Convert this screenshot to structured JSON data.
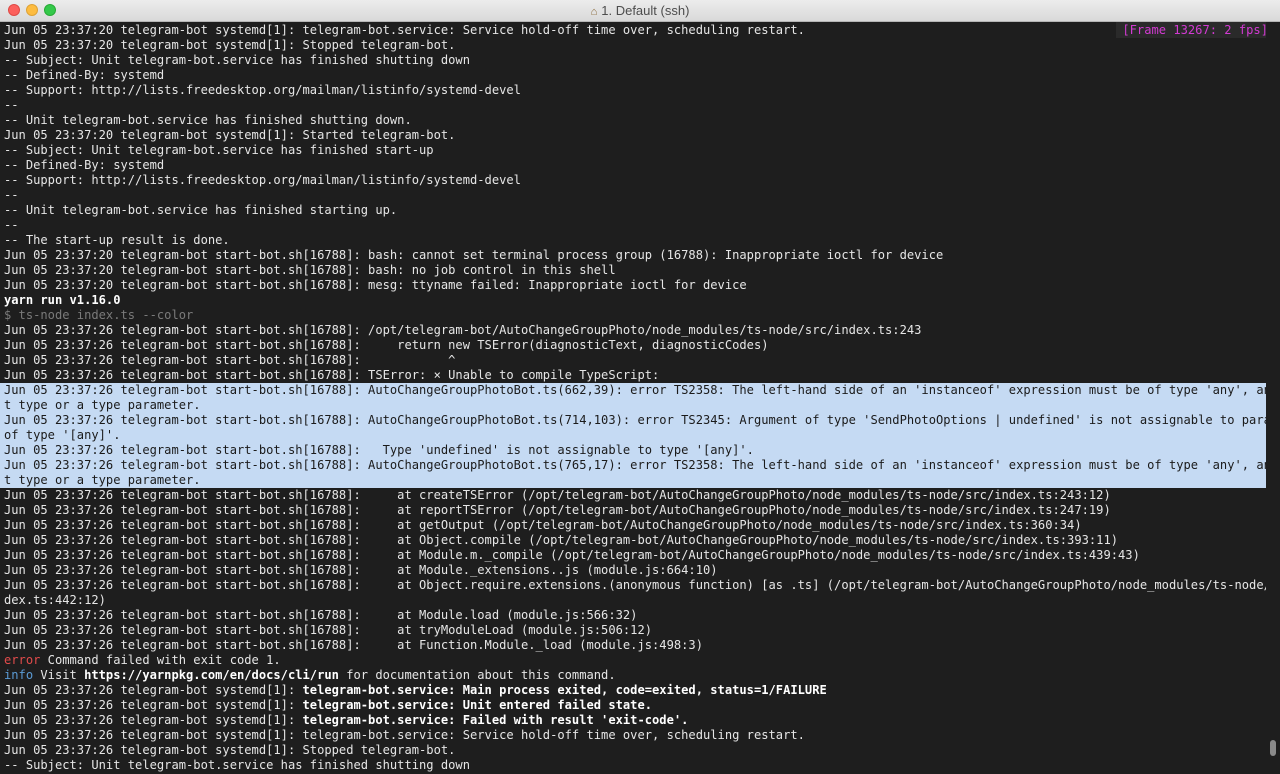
{
  "window": {
    "title": "1. Default (ssh)",
    "title_icon": "home-icon",
    "frame_badge": "[Frame 13267: 2 fps]"
  },
  "colors": {
    "background": "#1e1e1e",
    "foreground": "#e6e6e6",
    "selection": "#c5daf3",
    "error": "#e24b4b",
    "info": "#5b9bd5",
    "badge": "#d23ad2"
  },
  "terminal": {
    "lines": [
      "Jun 05 23:37:20 telegram-bot systemd[1]: telegram-bot.service: Service hold-off time over, scheduling restart.",
      "Jun 05 23:37:20 telegram-bot systemd[1]: Stopped telegram-bot.",
      "-- Subject: Unit telegram-bot.service has finished shutting down",
      "-- Defined-By: systemd",
      "-- Support: http://lists.freedesktop.org/mailman/listinfo/systemd-devel",
      "--",
      "-- Unit telegram-bot.service has finished shutting down.",
      "Jun 05 23:37:20 telegram-bot systemd[1]: Started telegram-bot.",
      "-- Subject: Unit telegram-bot.service has finished start-up",
      "-- Defined-By: systemd",
      "-- Support: http://lists.freedesktop.org/mailman/listinfo/systemd-devel",
      "--",
      "-- Unit telegram-bot.service has finished starting up.",
      "--",
      "-- The start-up result is done.",
      "Jun 05 23:37:20 telegram-bot start-bot.sh[16788]: bash: cannot set terminal process group (16788): Inappropriate ioctl for device",
      "Jun 05 23:37:20 telegram-bot start-bot.sh[16788]: bash: no job control in this shell",
      "Jun 05 23:37:20 telegram-bot start-bot.sh[16788]: mesg: ttyname failed: Inappropriate ioctl for device",
      "yarn run v1.16.0",
      "$ ts-node index.ts --color",
      "Jun 05 23:37:26 telegram-bot start-bot.sh[16788]: /opt/telegram-bot/AutoChangeGroupPhoto/node_modules/ts-node/src/index.ts:243",
      "Jun 05 23:37:26 telegram-bot start-bot.sh[16788]:     return new TSError(diagnosticText, diagnosticCodes)",
      "Jun 05 23:37:26 telegram-bot start-bot.sh[16788]:            ^",
      "Jun 05 23:37:26 telegram-bot start-bot.sh[16788]: TSError: × Unable to compile TypeScript:",
      "Jun 05 23:37:26 telegram-bot start-bot.sh[16788]: AutoChangeGroupPhotoBot.ts(662,39): error TS2358: The left-hand side of an 'instanceof' expression must be of type 'any', an objec",
      "t type or a type parameter.",
      "Jun 05 23:37:26 telegram-bot start-bot.sh[16788]: AutoChangeGroupPhotoBot.ts(714,103): error TS2345: Argument of type 'SendPhotoOptions | undefined' is not assignable to parameter",
      "of type '[any]'.",
      "Jun 05 23:37:26 telegram-bot start-bot.sh[16788]:   Type 'undefined' is not assignable to type '[any]'.",
      "Jun 05 23:37:26 telegram-bot start-bot.sh[16788]: AutoChangeGroupPhotoBot.ts(765,17): error TS2358: The left-hand side of an 'instanceof' expression must be of type 'any', an objec",
      "t type or a type parameter.",
      "Jun 05 23:37:26 telegram-bot start-bot.sh[16788]:     at createTSError (/opt/telegram-bot/AutoChangeGroupPhoto/node_modules/ts-node/src/index.ts:243:12)",
      "Jun 05 23:37:26 telegram-bot start-bot.sh[16788]:     at reportTSError (/opt/telegram-bot/AutoChangeGroupPhoto/node_modules/ts-node/src/index.ts:247:19)",
      "Jun 05 23:37:26 telegram-bot start-bot.sh[16788]:     at getOutput (/opt/telegram-bot/AutoChangeGroupPhoto/node_modules/ts-node/src/index.ts:360:34)",
      "Jun 05 23:37:26 telegram-bot start-bot.sh[16788]:     at Object.compile (/opt/telegram-bot/AutoChangeGroupPhoto/node_modules/ts-node/src/index.ts:393:11)",
      "Jun 05 23:37:26 telegram-bot start-bot.sh[16788]:     at Module.m._compile (/opt/telegram-bot/AutoChangeGroupPhoto/node_modules/ts-node/src/index.ts:439:43)",
      "Jun 05 23:37:26 telegram-bot start-bot.sh[16788]:     at Module._extensions..js (module.js:664:10)",
      "Jun 05 23:37:26 telegram-bot start-bot.sh[16788]:     at Object.require.extensions.(anonymous function) [as .ts] (/opt/telegram-bot/AutoChangeGroupPhoto/node_modules/ts-node/src/in",
      "dex.ts:442:12)",
      "Jun 05 23:37:26 telegram-bot start-bot.sh[16788]:     at Module.load (module.js:566:32)",
      "Jun 05 23:37:26 telegram-bot start-bot.sh[16788]:     at tryModuleLoad (module.js:506:12)",
      "Jun 05 23:37:26 telegram-bot start-bot.sh[16788]:     at Function.Module._load (module.js:498:3)"
    ],
    "error_line": {
      "tag": "error",
      "text": " Command failed with exit code 1."
    },
    "info_line": {
      "tag": "info",
      "pre": " Visit ",
      "url": "https://yarnpkg.com/en/docs/cli/run",
      "post": " for documentation about this command."
    },
    "failure_lines": [
      {
        "prefix": "Jun 05 23:37:26 telegram-bot systemd[1]: ",
        "bold": "telegram-bot.service: Main process exited, code=exited, status=1/FAILURE"
      },
      {
        "prefix": "Jun 05 23:37:26 telegram-bot systemd[1]: ",
        "bold": "telegram-bot.service: Unit entered failed state."
      },
      {
        "prefix": "Jun 05 23:37:26 telegram-bot systemd[1]: ",
        "bold": "telegram-bot.service: Failed with result 'exit-code'."
      }
    ],
    "tail_lines": [
      "Jun 05 23:37:26 telegram-bot systemd[1]: telegram-bot.service: Service hold-off time over, scheduling restart.",
      "Jun 05 23:37:26 telegram-bot systemd[1]: Stopped telegram-bot.",
      "-- Subject: Unit telegram-bot.service has finished shutting down"
    ]
  }
}
